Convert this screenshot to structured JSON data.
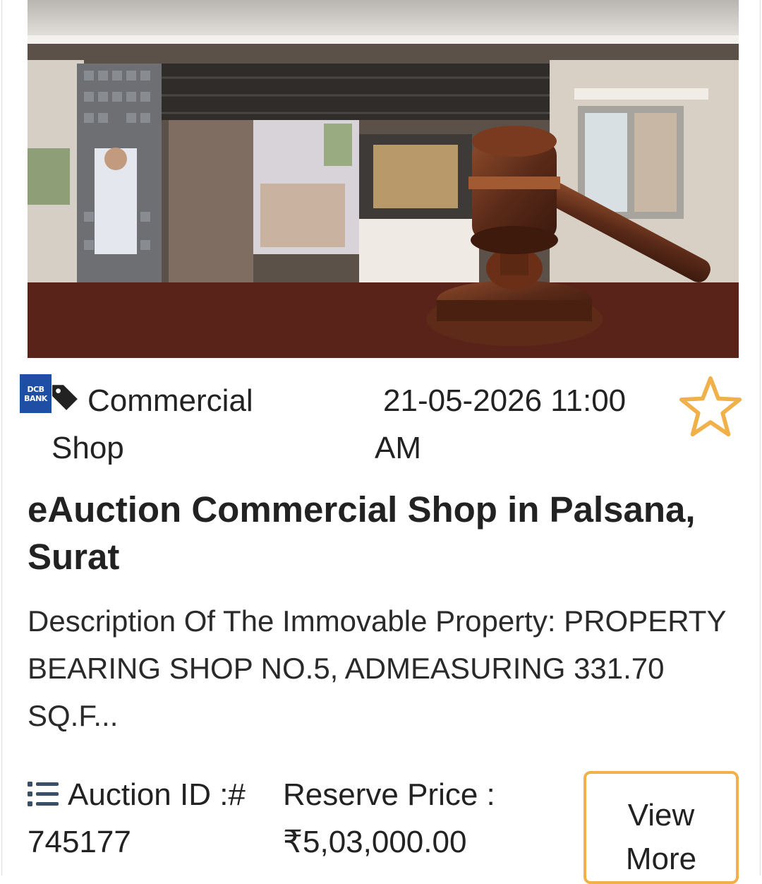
{
  "listing": {
    "bank_logo_line1": "DCB",
    "bank_logo_line2": "BANK",
    "category": "Commercial Shop",
    "auction_datetime": "21-05-2026 11:00 AM",
    "title": "eAuction Commercial Shop in Palsana, Surat",
    "description": "Description Of The Immovable Property: PROPERTY BEARING SHOP NO.5, ADMEASURING 331.70 SQ.F...",
    "auction_id": "Auction ID :# 745177",
    "reserve_price": "Reserve Price : ₹5,03,000.00",
    "view_more_label": "View More"
  },
  "icons": {
    "tag": "tag-icon",
    "favorite": "star-outline-icon",
    "list": "list-icon"
  },
  "colors": {
    "accent": "#f0b04a",
    "bank_blue": "#1f4fa5",
    "text": "#222222"
  }
}
